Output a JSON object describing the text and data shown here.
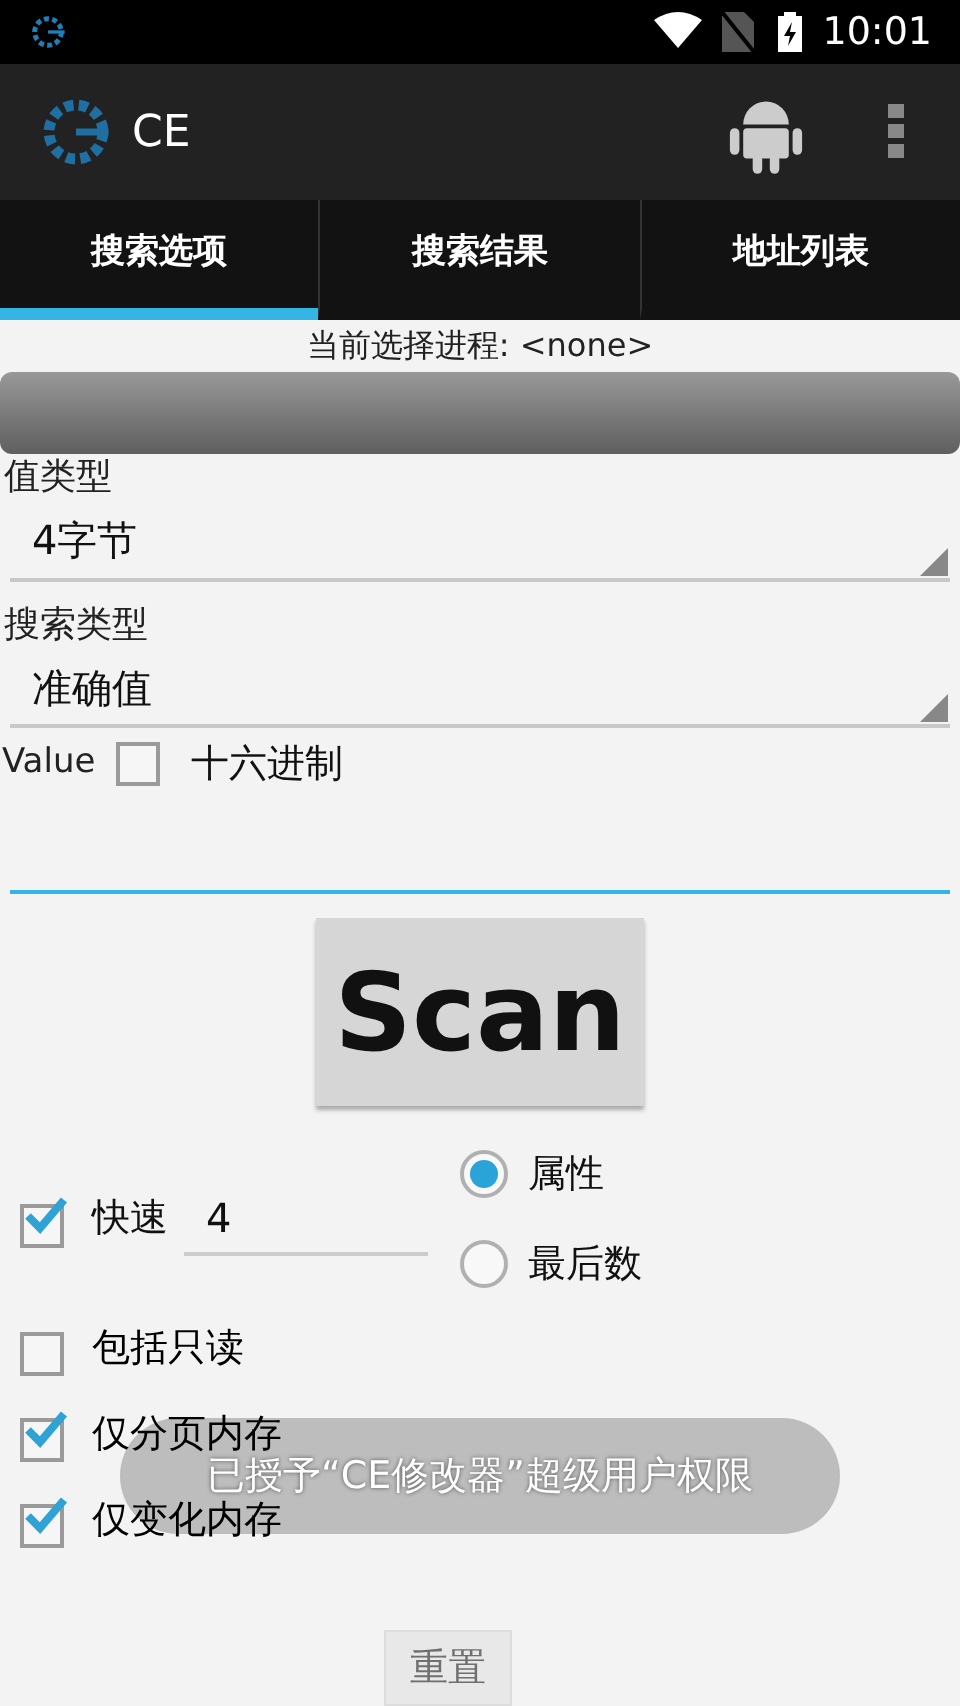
{
  "status_bar": {
    "time": "10:01"
  },
  "action_bar": {
    "title": "CE"
  },
  "tabs": [
    {
      "label": "搜索选项",
      "selected": true
    },
    {
      "label": "搜索结果",
      "selected": false
    },
    {
      "label": "地址列表",
      "selected": false
    }
  ],
  "process_label": "当前选择进程: <none>",
  "value_type": {
    "label": "值类型",
    "value": "4字节"
  },
  "search_type": {
    "label": "搜索类型",
    "value": "准确值"
  },
  "value_row": {
    "label": "Value",
    "hex": {
      "label": "十六进制",
      "checked": false
    }
  },
  "scan_button": "Scan",
  "fast": {
    "label": "快速",
    "checked": true,
    "value": "4"
  },
  "radios": [
    {
      "label": "属性",
      "selected": true
    },
    {
      "label": "最后数",
      "selected": false
    }
  ],
  "options": [
    {
      "label": "包括只读",
      "checked": false
    },
    {
      "label": "仅分页内存",
      "checked": true
    },
    {
      "label": "仅变化内存",
      "checked": true
    }
  ],
  "reset_button": {
    "label": "重置",
    "disabled": true
  },
  "toast": "已授予“CE修改器”超级用户权限"
}
